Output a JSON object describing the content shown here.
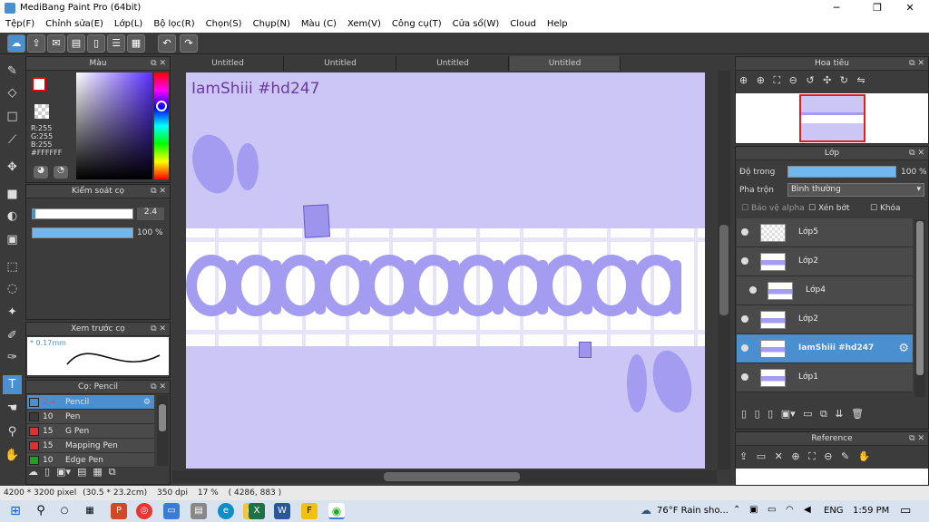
{
  "window": {
    "title": "MediBang Paint Pro (64bit)",
    "min": "─",
    "max": "❐",
    "close": "✕"
  },
  "menu": [
    "Tệp(F)",
    "Chỉnh sửa(E)",
    "Lớp(L)",
    "Bộ lọc(R)",
    "Chọn(S)",
    "Chụp(N)",
    "Màu (C)",
    "Xem(V)",
    "Công cụ(T)",
    "Cửa sổ(W)",
    "Cloud",
    "Help"
  ],
  "color_panel": {
    "title": "Màu",
    "r": "R:255",
    "g": "G:255",
    "b": "B:255",
    "hex": "#FFFFFF"
  },
  "brush_control": {
    "title": "Kiểm soát cọ",
    "size": "2.4",
    "opacity": "100 %",
    "size_fraction": 0.95,
    "opacity_fraction": 1.0
  },
  "brush_preview": {
    "title": "Xem trước cọ",
    "size": "0.17mm"
  },
  "brushes": {
    "title": "Cọ: Pencil",
    "items": [
      {
        "size": "2.4",
        "name": "Pencil",
        "color": "#4a8fd0"
      },
      {
        "size": "10",
        "name": "Pen",
        "color": "#3a3a3a"
      },
      {
        "size": "15",
        "name": "G Pen",
        "color": "#e03030"
      },
      {
        "size": "15",
        "name": "Mapping Pen",
        "color": "#e03030"
      },
      {
        "size": "10",
        "name": "Edge Pen",
        "color": "#20a020"
      }
    ]
  },
  "doc_tabs": [
    "Untitled",
    "Untitled",
    "Untitled",
    "Untitled"
  ],
  "canvas": {
    "watermark": "IamShiii #hd247",
    "bg": "#ccc6f7",
    "stripe": "#ffffff",
    "letter": "#a49cf0"
  },
  "navigator": {
    "title": "Hoa tiêu"
  },
  "layer_panel": {
    "title": "Lớp",
    "opacity_label": "Độ trong",
    "opacity_value": "100 %",
    "opacity_fraction": 1.0,
    "blend_label": "Pha trộn",
    "blend_value": "Bình thường",
    "protect_alpha": "Bảo vệ alpha",
    "clip": "Xén bớt",
    "lock": "Khóa"
  },
  "layers": [
    {
      "name": "Lớp5"
    },
    {
      "name": "Lớp2"
    },
    {
      "name": "Lớp4"
    },
    {
      "name": "Lớp2"
    },
    {
      "name": "IamShiii #hd247"
    },
    {
      "name": "Lớp1"
    }
  ],
  "reference": {
    "title": "Reference"
  },
  "status": {
    "dims": "4200 * 3200 pixel",
    "cm": "(30.5 * 23.2cm)",
    "dpi": "350 dpi",
    "zoom": "17 %",
    "coords": "( 4286, 883 )"
  },
  "taskbar": {
    "weather": "76°F  Rain sho...",
    "lang": "ENG",
    "time": "1:59 PM"
  }
}
